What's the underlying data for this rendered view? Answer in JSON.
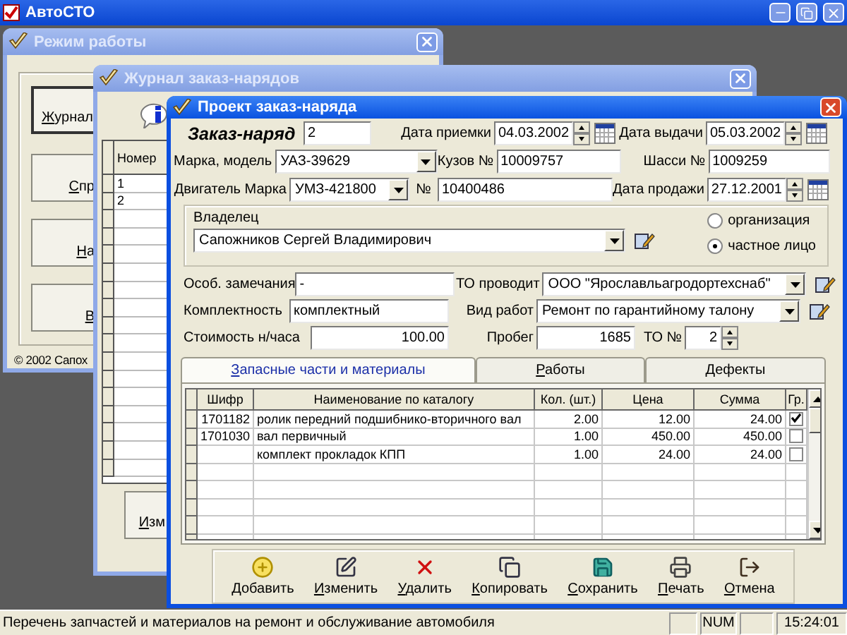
{
  "app": {
    "title": "АвтоСТО"
  },
  "mode_window": {
    "title": "Режим работы",
    "buttons": [
      {
        "label": "Журнал",
        "default": true
      },
      {
        "label": "Спр",
        "default": false
      },
      {
        "label": "На",
        "default": false
      },
      {
        "label": "В",
        "default": false
      }
    ],
    "footer": "© 2002 Сапох"
  },
  "journal_window": {
    "title": "Журнал заказ-нарядов",
    "columns": [
      "Номер"
    ],
    "rows": [
      {
        "number": "1"
      },
      {
        "number": "2"
      }
    ],
    "button": "Изм"
  },
  "order_window": {
    "title": "Проект заказ-наряда",
    "heading": "Заказ-наряд",
    "number": "2",
    "received": {
      "label": "Дата приемки",
      "value": "04.03.2002"
    },
    "issued": {
      "label": "Дата выдачи",
      "value": "05.03.2002"
    },
    "model": {
      "label": "Марка, модель",
      "value": "УАЗ-39629"
    },
    "body": {
      "label": "Кузов №",
      "value": "10009757"
    },
    "chassis": {
      "label": "Шасси №",
      "value": "1009259"
    },
    "engine": {
      "label": "Двигатель Марка",
      "value": "УМЗ-421800"
    },
    "engine_no": {
      "label": "№",
      "value": "10400486"
    },
    "sold": {
      "label": "Дата продажи",
      "value": "27.12.2001"
    },
    "owner": {
      "label": "Владелец",
      "value": "Сапожников Сергей Владимирович",
      "types": [
        {
          "label": "организация",
          "selected": false
        },
        {
          "label": "частное лицо",
          "selected": true
        }
      ]
    },
    "notes": {
      "label": "Особ. замечания",
      "value": "-"
    },
    "service_by": {
      "label": "ТО проводит",
      "value": "ООО \"Ярославльагродортехснаб\""
    },
    "completeness": {
      "label": "Комплектность",
      "value": "комплектный"
    },
    "work_type": {
      "label": "Вид работ",
      "value": "Ремонт по гарантийному талону"
    },
    "hour_rate": {
      "label": "Стоимость н/часа",
      "value": "100.00"
    },
    "mileage": {
      "label": "Пробег",
      "value": "1685"
    },
    "to_number": {
      "label": "ТО №",
      "value": "2"
    },
    "tabs": [
      {
        "label": "Запасные части и материалы",
        "selected": true
      },
      {
        "label": "Работы",
        "selected": false
      },
      {
        "label": "Дефекты",
        "selected": false
      }
    ],
    "table": {
      "columns": [
        "Шифр",
        "Наименование по каталогу",
        "Кол. (шт.)",
        "Цена",
        "Сумма",
        "Гр."
      ],
      "rows": [
        {
          "code": "1701182",
          "name": "ролик передний подшибнико-вторичного вал",
          "qty": "2.00",
          "price": "12.00",
          "sum": "24.00",
          "group": true
        },
        {
          "code": "1701030",
          "name": "вал первичный",
          "qty": "1.00",
          "price": "450.00",
          "sum": "450.00",
          "group": false
        },
        {
          "name": "комплект прокладок КПП",
          "qty": "1.00",
          "price": "24.00",
          "sum": "24.00",
          "group": false
        }
      ]
    },
    "actions": [
      {
        "kind": "add",
        "label": "Добавить"
      },
      {
        "kind": "edit",
        "label": "Изменить"
      },
      {
        "kind": "delete",
        "label": "Удалить"
      },
      {
        "kind": "copy",
        "label": "Копировать"
      },
      {
        "kind": "save",
        "label": "Сохранить"
      },
      {
        "kind": "print",
        "label": "Печать"
      },
      {
        "kind": "cancel",
        "label": "Отмена"
      }
    ]
  },
  "status_bar": {
    "message": "Перечень запчастей и материалов на ремонт и обслуживание автомобиля",
    "indicator": "NUM",
    "clock": "15:24:01"
  }
}
